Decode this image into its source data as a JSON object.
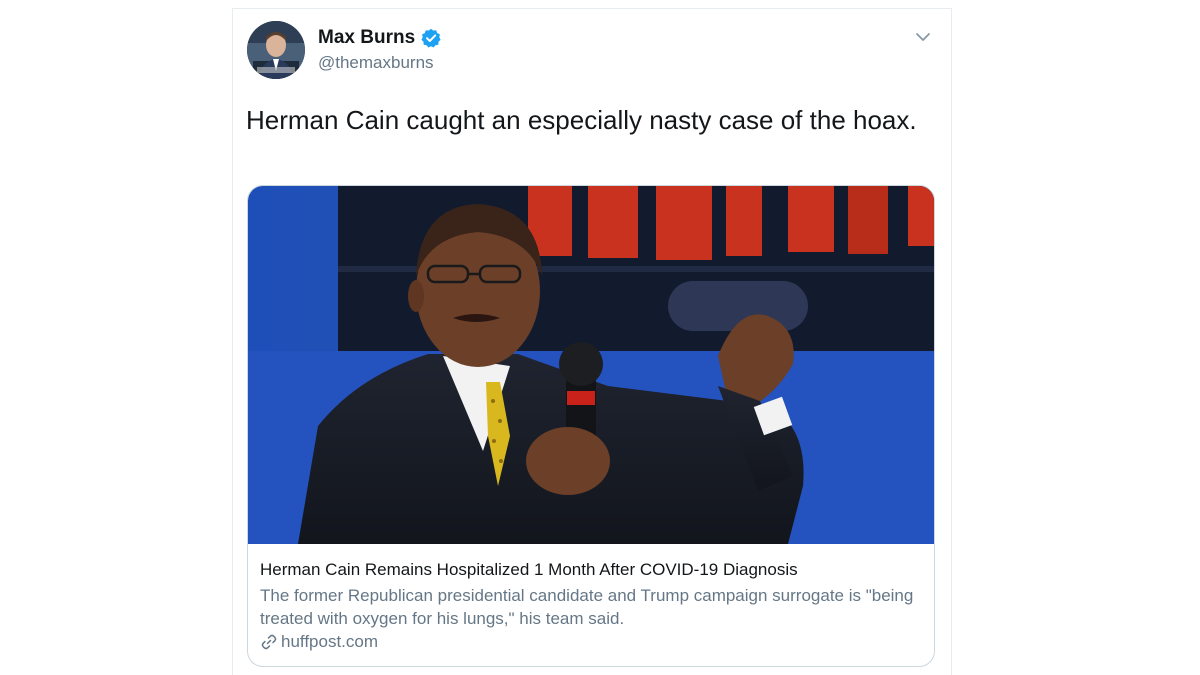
{
  "tweet": {
    "author": {
      "name": "Max Burns",
      "handle": "@themaxburns",
      "verified": true,
      "avatar_icon": "profile-photo"
    },
    "text": "Herman Cain caught an especially nasty case of the hoax.",
    "menu_icon": "chevron-down-icon"
  },
  "link_card": {
    "image_description_icon": "article-photo",
    "title": "Herman Cain Remains Hospitalized 1 Month After COVID-19 Diagnosis",
    "description": "The former Republican presidential candidate and Trump campaign surrogate is \"being treated with oxygen for his lungs,\" his team said.",
    "domain": "huffpost.com",
    "domain_icon": "link-icon"
  },
  "colors": {
    "verified_blue": "#1da1f2",
    "secondary_text": "#657786",
    "primary_text": "#14171a",
    "border": "#ccd6dd"
  }
}
